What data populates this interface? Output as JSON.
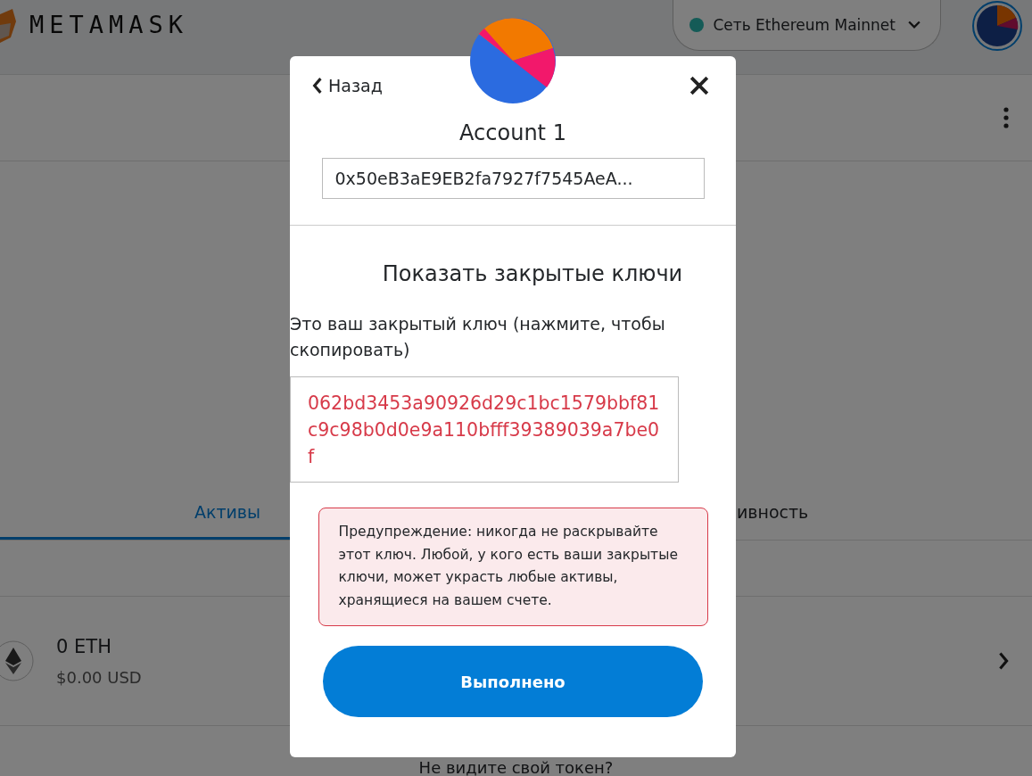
{
  "header": {
    "logo": "METAMASK",
    "network": {
      "label": "Сеть Ethereum Mainnet",
      "color": "#145b57"
    }
  },
  "tabs": [
    {
      "label": "Активы",
      "selected": true
    },
    {
      "label": "ивность",
      "selected": false
    }
  ],
  "asset": {
    "amount": "0 ETH",
    "fiat": "$0.00 USD"
  },
  "footer_text": "Не видите свой токен?",
  "modal": {
    "back": "Назад",
    "account_name": "Account 1",
    "address": "0x50eB3aE9EB2fa7927f7545AeA...",
    "title": "Показать закрытые ключи",
    "label": "Это ваш закрытый ключ (нажмите, чтобы скопировать)",
    "private_key": "062bd3453a90926d29c1bc1579bbf81c9c98b0d0e9a110bfff39389039a7be0f",
    "warning": "Предупреждение: никогда не раскрывайте этот ключ. Любой, у кого есть ваши закрытые ключи, может украсть любые активы, хранящиеся на вашем счете.",
    "done": "Выполнено"
  }
}
